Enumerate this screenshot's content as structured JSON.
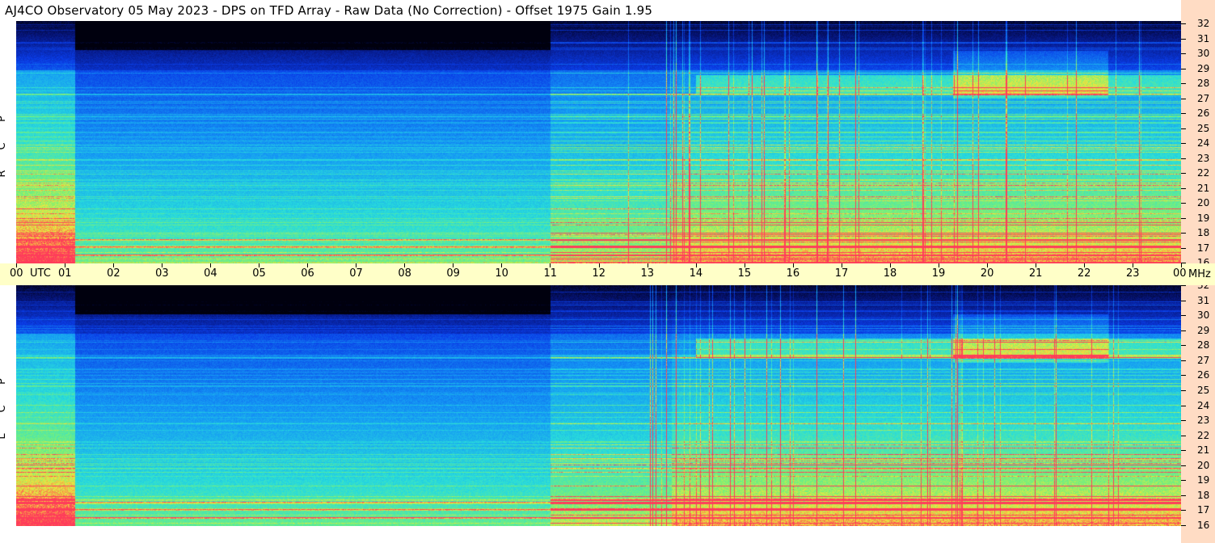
{
  "header": {
    "title": "AJ4CO Observatory  05 May 2023  -  DPS on TFD Array  -  Raw Data (No Correction)  -  Offset 1975  Gain 1.95"
  },
  "panels": {
    "top_label": [
      "R",
      "C",
      "P"
    ],
    "bottom_label": [
      "L",
      "C",
      "P"
    ]
  },
  "time_axis": {
    "labels": [
      "00",
      "01",
      "02",
      "03",
      "04",
      "05",
      "06",
      "07",
      "08",
      "09",
      "10",
      "11",
      "12",
      "13",
      "14",
      "15",
      "16",
      "17",
      "18",
      "19",
      "20",
      "21",
      "22",
      "23",
      "00"
    ],
    "utc_label": "UTC",
    "unit_label": "MHz"
  },
  "freq_axis": {
    "labels": [
      "32",
      "31",
      "30",
      "29",
      "28",
      "27",
      "26",
      "25",
      "24",
      "23",
      "22",
      "21",
      "20",
      "19",
      "18",
      "17",
      "16"
    ]
  },
  "colors": {
    "background_dark": "#000010",
    "cold": "#0a2fd0",
    "mid": "#1aa9f0",
    "warm": "#30e0c0",
    "hot": "#f0e040",
    "interference": "#ff3060",
    "time_bar": "#ffffc8",
    "freq_axis_bg": "#ffdcc4"
  }
}
